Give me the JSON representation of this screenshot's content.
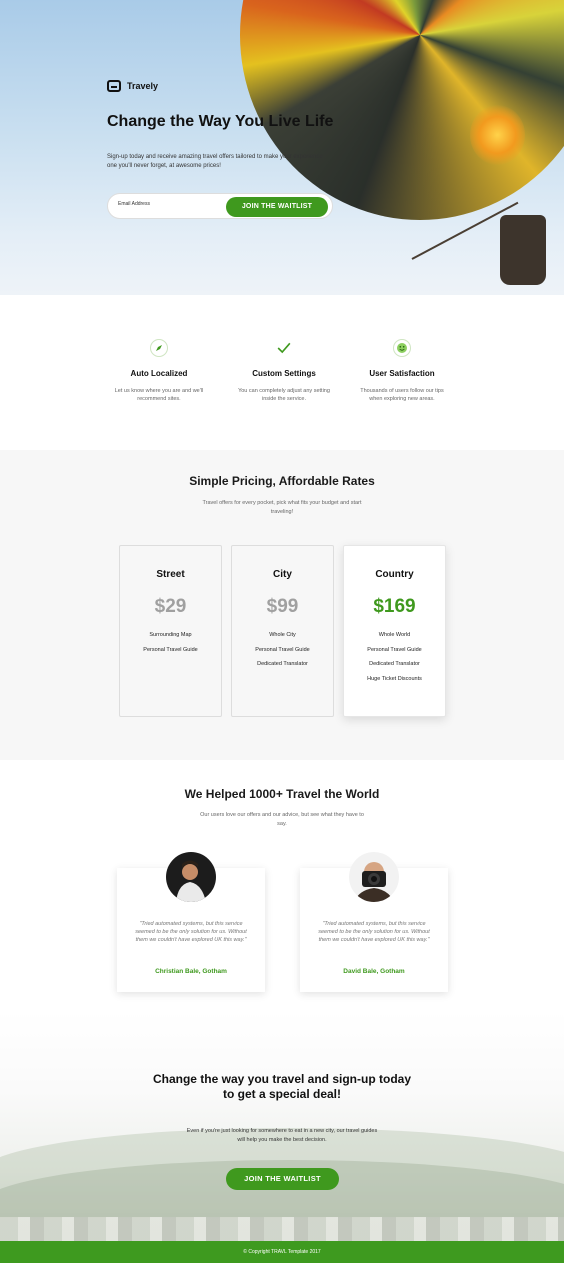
{
  "brand": {
    "name": "Travely"
  },
  "hero": {
    "title": "Change the Way You Live Life",
    "subtitle": "Sign-up today and receive amazing travel offers tailored to make your experience one you'll never forget, at awesome prices!",
    "email_placeholder": "Email Address",
    "join_label": "JOIN THE WAITLIST"
  },
  "features": [
    {
      "icon": "compass-icon",
      "title": "Auto Localized",
      "desc": "Let us know where you are and we'll recommend sites."
    },
    {
      "icon": "checkmark-icon",
      "title": "Custom Settings",
      "desc": "You can completely adjust any setting inside the service."
    },
    {
      "icon": "smiley-icon",
      "title": "User Satisfaction",
      "desc": "Thousands of users follow our tips when exploring new areas."
    }
  ],
  "pricing": {
    "title": "Simple Pricing, Affordable Rates",
    "subtitle": "Travel offers for every pocket, pick what fits your budget and start traveling!",
    "plans": [
      {
        "name": "Street",
        "price": "$29",
        "features": [
          "Surrounding Map",
          "Personal Travel Guide"
        ]
      },
      {
        "name": "City",
        "price": "$99",
        "features": [
          "Whole City",
          "Personal Travel Guide",
          "Dedicated Translator"
        ]
      },
      {
        "name": "Country",
        "price": "$169",
        "features": [
          "Whole World",
          "Personal Travel Guide",
          "Dedicated Translator",
          "Huge Ticket Discounts"
        ]
      }
    ]
  },
  "testimonials": {
    "title": "We Helped 1000+ Travel the World",
    "subtitle": "Our users love our offers and our advice, but see what they have to say.",
    "items": [
      {
        "quote": "\"Tried automated systems, but this service seemed to be the only solution for us. Without them we couldn't have explored UK this way.\"",
        "author": "Christian Bale, Gotham"
      },
      {
        "quote": "\"Tried automated systems, but this service seemed to be the only solution for us. Without them we couldn't have explored UK this way.\"",
        "author": "David Bale, Gotham"
      }
    ]
  },
  "cta": {
    "title": "Change the way you travel and sign-up today to get a special deal!",
    "subtitle": "Even if you're just looking for somewhere to eat in a new city, our travel guides will help you make the best decision.",
    "button_label": "JOIN THE WAITLIST"
  },
  "footer": {
    "text": "© Copyright TRAVL Template 2017"
  },
  "colors": {
    "accent": "#3f991e",
    "price_muted": "#a0a0a0"
  }
}
